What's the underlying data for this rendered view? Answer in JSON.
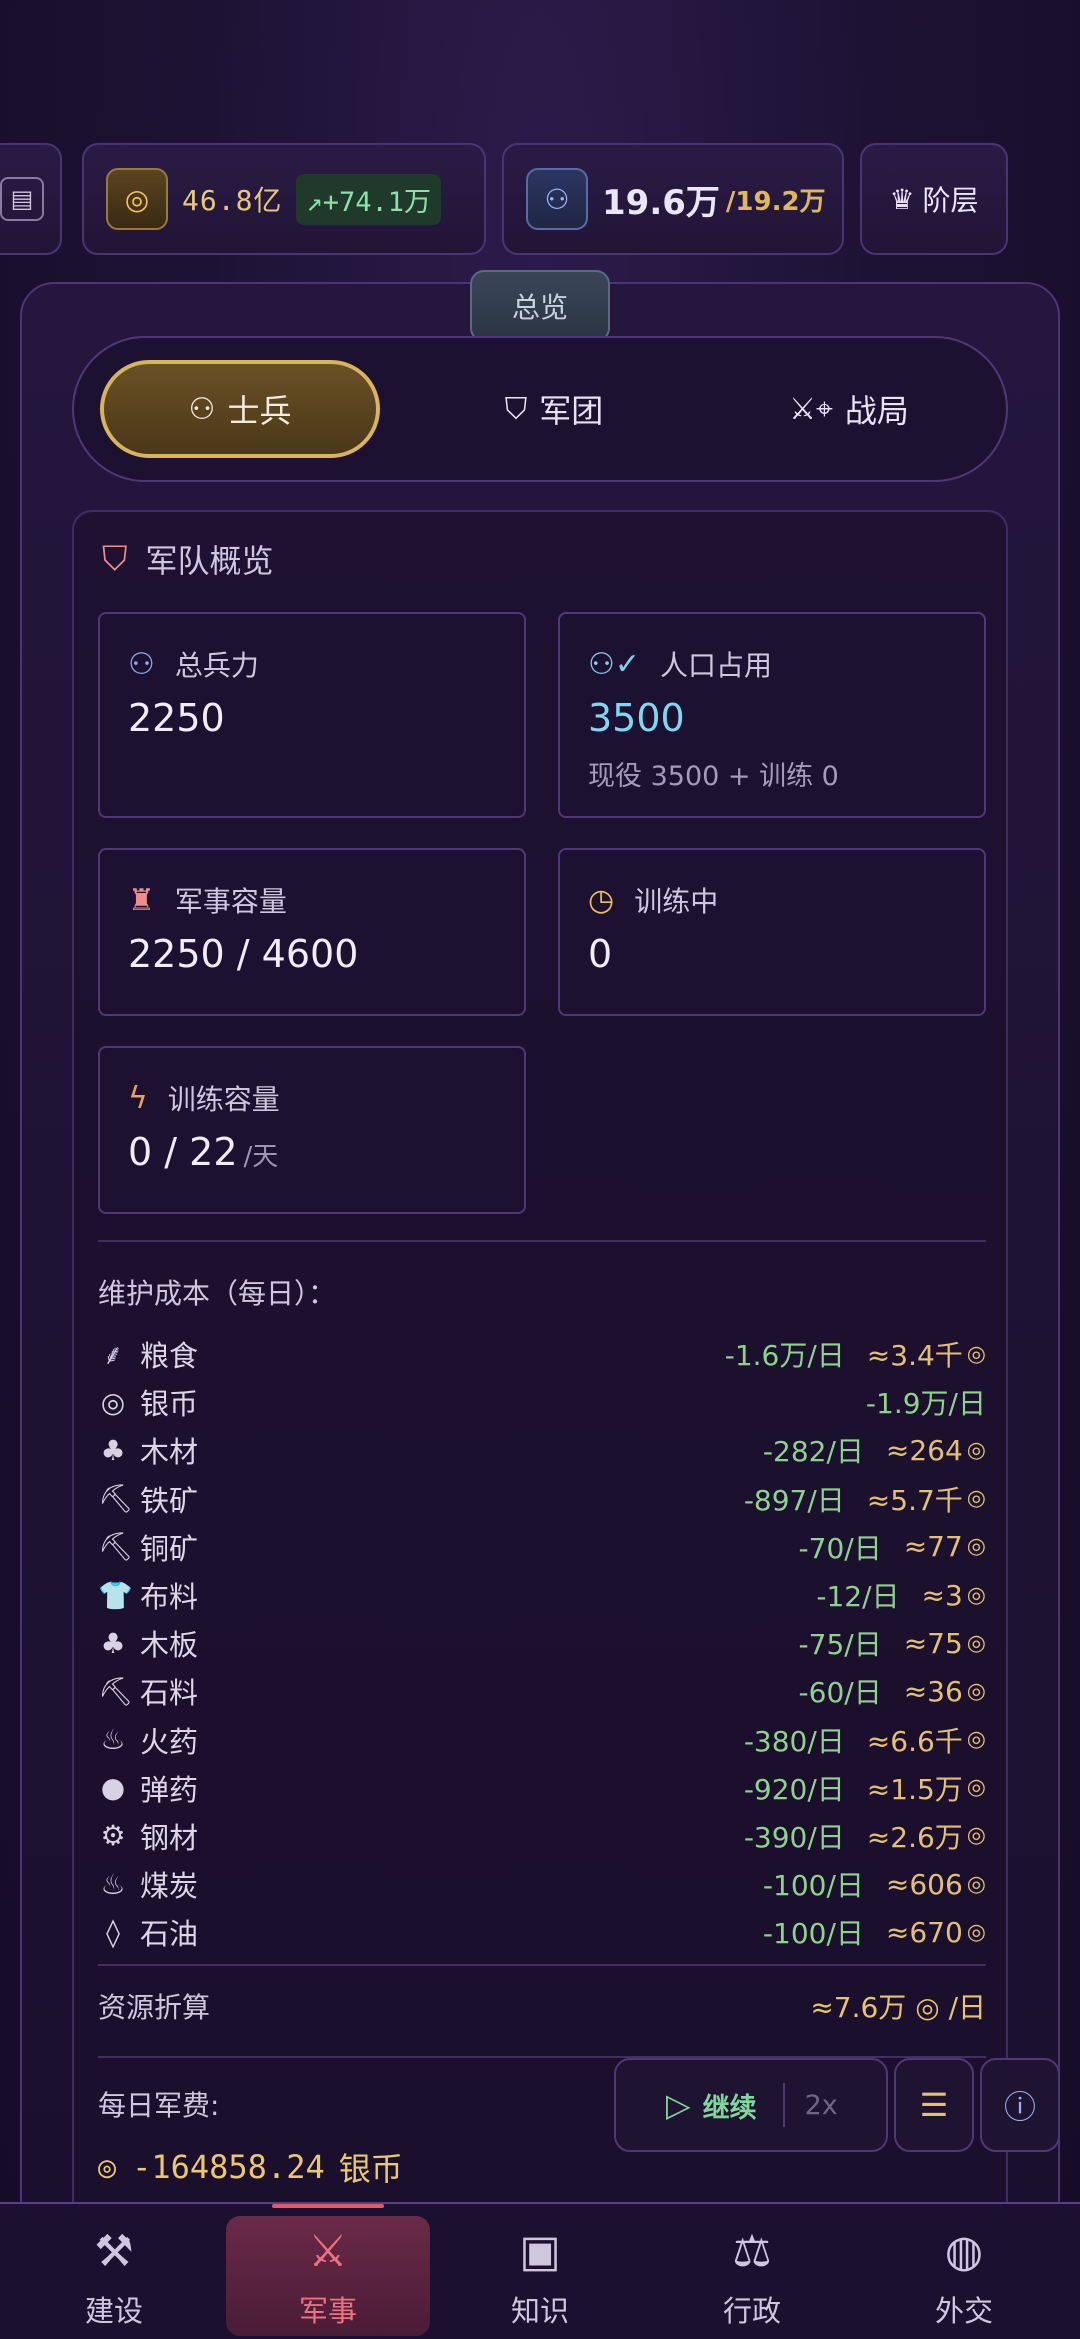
{
  "topbar": {
    "silver": "46.8亿",
    "silver_delta": "+74.1万",
    "population": "19.6万",
    "population_max": "/19.2万",
    "tier_label": "阶层"
  },
  "overview_tab": "总览",
  "tabs": [
    {
      "label": "士兵",
      "icon": "users-icon"
    },
    {
      "label": "军团",
      "icon": "shield-icon"
    },
    {
      "label": "战局",
      "icon": "swords-map-pin-icon"
    }
  ],
  "army": {
    "title": "军队概览",
    "stats": {
      "total_troops": {
        "label": "总兵力",
        "value": "2250"
      },
      "population_use": {
        "label": "人口占用",
        "value": "3500",
        "sub": "现役 3500 + 训练 0"
      },
      "military_capacity": {
        "label": "军事容量",
        "value": "2250 / 4600"
      },
      "training": {
        "label": "训练中",
        "value": "0"
      },
      "training_capacity": {
        "label": "训练容量",
        "value": "0 / 22",
        "unit": "/天"
      }
    },
    "cost_title": "维护成本（每日）：",
    "costs": [
      {
        "name": "粮食",
        "icon": "wheat-icon",
        "value": "-1.6万/日",
        "approx": "≈3.4千"
      },
      {
        "name": "银币",
        "icon": "coins-icon",
        "value": "-1.9万/日",
        "approx": ""
      },
      {
        "name": "木材",
        "icon": "tree-icon",
        "value": "-282/日",
        "approx": "≈264"
      },
      {
        "name": "铁矿",
        "icon": "pickaxe-icon",
        "value": "-897/日",
        "approx": "≈5.7千"
      },
      {
        "name": "铜矿",
        "icon": "pickaxe-icon",
        "value": "-70/日",
        "approx": "≈77"
      },
      {
        "name": "布料",
        "icon": "shirt-icon",
        "value": "-12/日",
        "approx": "≈3"
      },
      {
        "name": "木板",
        "icon": "tree-icon",
        "value": "-75/日",
        "approx": "≈75"
      },
      {
        "name": "石料",
        "icon": "pickaxe-icon",
        "value": "-60/日",
        "approx": "≈36"
      },
      {
        "name": "火药",
        "icon": "flame-icon",
        "value": "-380/日",
        "approx": "≈6.6千"
      },
      {
        "name": "弹药",
        "icon": "bomb-icon",
        "value": "-920/日",
        "approx": "≈1.5万"
      },
      {
        "name": "钢材",
        "icon": "cog-icon",
        "value": "-390/日",
        "approx": "≈2.6万"
      },
      {
        "name": "煤炭",
        "icon": "flame-icon",
        "value": "-100/日",
        "approx": "≈606"
      },
      {
        "name": "石油",
        "icon": "droplet-icon",
        "value": "-100/日",
        "approx": "≈670"
      }
    ],
    "conversion_label": "资源折算",
    "conversion_value": "≈7.6万",
    "conversion_unit": "/日",
    "daily_label": "每日军费:",
    "daily_value": "-164858.24",
    "daily_unit": "银币"
  },
  "controls": {
    "play_label": "继续",
    "speed_label": "2x"
  },
  "nav": [
    {
      "label": "建设",
      "icon": "hammer-icon"
    },
    {
      "label": "军事",
      "icon": "crossed-swords-icon"
    },
    {
      "label": "知识",
      "icon": "chip-icon"
    },
    {
      "label": "行政",
      "icon": "gavel-icon"
    },
    {
      "label": "外交",
      "icon": "globe-icon"
    }
  ],
  "colors": {
    "accent_gold": "#d8b45a",
    "military_active": "#f07080",
    "positive_green": "#8ed38a",
    "approx_gold": "#e4c070"
  }
}
